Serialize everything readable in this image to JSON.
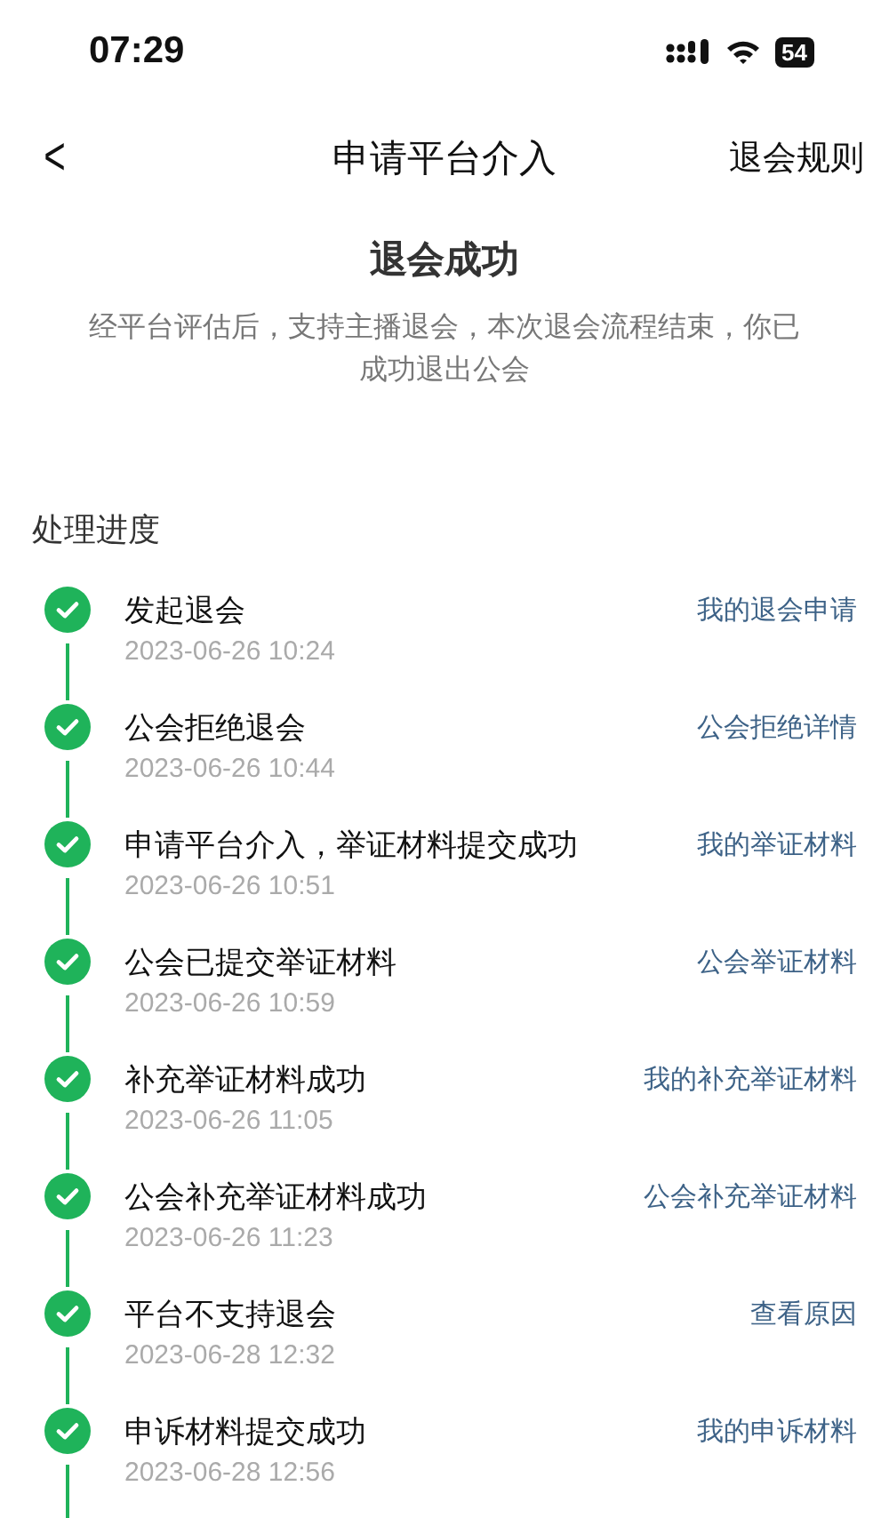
{
  "status_bar": {
    "time": "07:29",
    "battery": "54"
  },
  "nav": {
    "back": "<",
    "title": "申请平台介入",
    "action": "退会规则"
  },
  "result": {
    "title": "退会成功",
    "description": "经平台评估后，支持主播退会，本次退会流程结束，你已成功退出公会"
  },
  "progress": {
    "heading": "处理进度",
    "steps": [
      {
        "title": "发起退会",
        "time": "2023-06-26 10:24",
        "link": "我的退会申请",
        "done": true
      },
      {
        "title": "公会拒绝退会",
        "time": "2023-06-26 10:44",
        "link": "公会拒绝详情",
        "done": true
      },
      {
        "title": "申请平台介入，举证材料提交成功",
        "time": "2023-06-26 10:51",
        "link": "我的举证材料",
        "done": true
      },
      {
        "title": "公会已提交举证材料",
        "time": "2023-06-26 10:59",
        "link": "公会举证材料",
        "done": true
      },
      {
        "title": "补充举证材料成功",
        "time": "2023-06-26 11:05",
        "link": "我的补充举证材料",
        "done": true
      },
      {
        "title": "公会补充举证材料成功",
        "time": "2023-06-26 11:23",
        "link": "公会补充举证材料",
        "done": true
      },
      {
        "title": "平台不支持退会",
        "time": "2023-06-28 12:32",
        "link": "查看原因",
        "done": true
      },
      {
        "title": "申诉材料提交成功",
        "time": "2023-06-28 12:56",
        "link": "我的申诉材料",
        "done": true
      }
    ]
  }
}
